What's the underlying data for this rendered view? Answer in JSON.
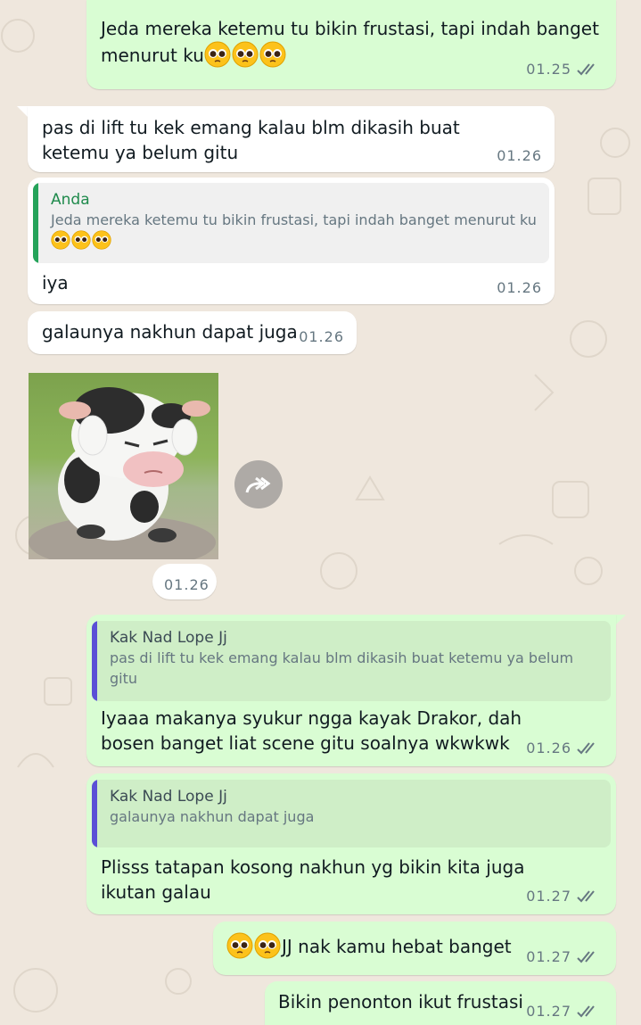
{
  "colors": {
    "chat_background": "#efe7dd",
    "outgoing_bubble": "#d9fdd3",
    "incoming_bubble": "#ffffff",
    "quote_bar_self": "#25a35a",
    "quote_bar_contact": "#5b4fd6",
    "read_ticks": "#667781"
  },
  "messages": [
    {
      "direction": "out",
      "text": "Jeda mereka ketemu tu bikin frustasi, tapi indah banget menurut ku",
      "emojis": [
        "pleading-face-emoji",
        "pleading-face-emoji",
        "pleading-face-emoji"
      ],
      "time": "01.25",
      "status": "read"
    },
    {
      "direction": "in",
      "text": "pas di lift tu kek emang kalau blm dikasih buat ketemu ya belum gitu",
      "time": "01.26"
    },
    {
      "direction": "in",
      "quote": {
        "author": "Anda",
        "text": "Jeda mereka ketemu tu bikin frustasi, tapi indah banget menurut ku"
      },
      "text": "iya",
      "time": "01.26"
    },
    {
      "direction": "in",
      "text": "galaunya nakhun dapat juga",
      "time": "01.26"
    },
    {
      "direction": "in",
      "type": "sticker",
      "sticker_icon": "sad-cow-sticker",
      "forward_icon": "forward-icon",
      "time": "01.26"
    },
    {
      "direction": "out",
      "quote": {
        "author": "Kak Nad Lope Jj",
        "text": "pas di lift tu kek emang kalau blm dikasih buat ketemu ya belum gitu"
      },
      "text": "Iyaaa makanya syukur ngga kayak Drakor, dah bosen banget liat scene gitu soalnya wkwkwk",
      "time": "01.26",
      "status": "read"
    },
    {
      "direction": "out",
      "quote": {
        "author": "Kak Nad Lope Jj",
        "text": "galaunya nakhun dapat juga"
      },
      "text": "Plisss tatapan kosong nakhun yg bikin kita juga ikutan galau",
      "time": "01.27",
      "status": "read"
    },
    {
      "direction": "out",
      "emojis": [
        "pleading-face-emoji",
        "pleading-face-emoji"
      ],
      "text": "JJ nak kamu hebat banget",
      "time": "01.27",
      "status": "read"
    },
    {
      "direction": "out",
      "text": "Bikin penonton ikut frustasi",
      "time": "01.27",
      "status": "read"
    }
  ]
}
